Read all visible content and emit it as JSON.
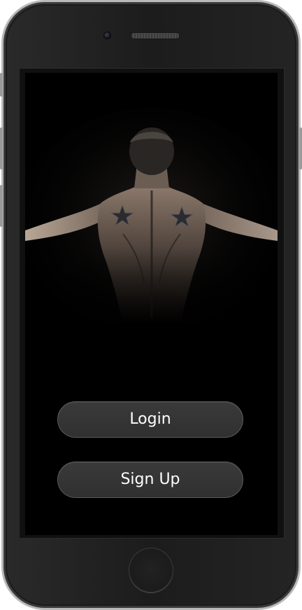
{
  "app": {
    "hero_image": "muscular-back-hero",
    "background_color": "#000000",
    "button_color": "#333333",
    "button_border_color": "#5a5a5a",
    "button_text_color": "#ffffff"
  },
  "device": {
    "camera_icon": "front-camera-icon",
    "speaker_icon": "earpiece-speaker-icon",
    "home_icon": "home-button-icon"
  },
  "actions": {
    "login_label": "Login",
    "signup_label": "Sign Up"
  }
}
